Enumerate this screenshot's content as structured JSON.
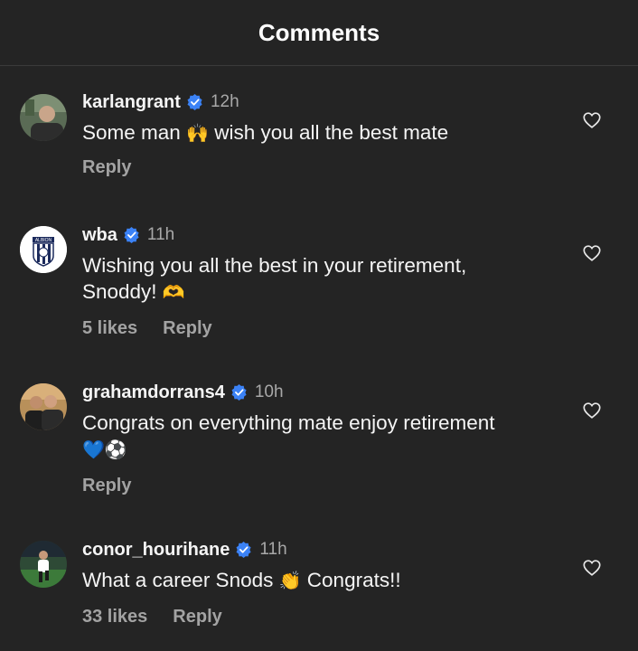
{
  "header": {
    "title": "Comments"
  },
  "comments": [
    {
      "username": "karlangrant",
      "time": "12h",
      "text_before": "Some man",
      "emoji1": "🙌",
      "text_after": "wish you all the best mate",
      "emoji2": "",
      "likes": "",
      "reply_label": "Reply"
    },
    {
      "username": "wba",
      "time": "11h",
      "text_before": "Wishing you all the best in your retirement, Snoddy!",
      "emoji1": "🫶",
      "text_after": "",
      "emoji2": "",
      "likes": "5 likes",
      "reply_label": "Reply",
      "avatar_text": "ALBION"
    },
    {
      "username": "grahamdorrans4",
      "time": "10h",
      "text_before": "Congrats on everything mate enjoy retirement",
      "emoji1": "💙",
      "text_after": "",
      "emoji2": "⚽",
      "likes": "",
      "reply_label": "Reply"
    },
    {
      "username": "conor_hourihane",
      "time": "11h",
      "text_before": "What a career Snods",
      "emoji1": "👏",
      "text_after": "Congrats!!",
      "emoji2": "",
      "likes": "33 likes",
      "reply_label": "Reply"
    }
  ],
  "colors": {
    "background": "#242424",
    "verified": "#3b82f6",
    "secondary_text": "#a8a8a8"
  },
  "icons": [
    "verified-badge-icon",
    "heart-icon"
  ]
}
